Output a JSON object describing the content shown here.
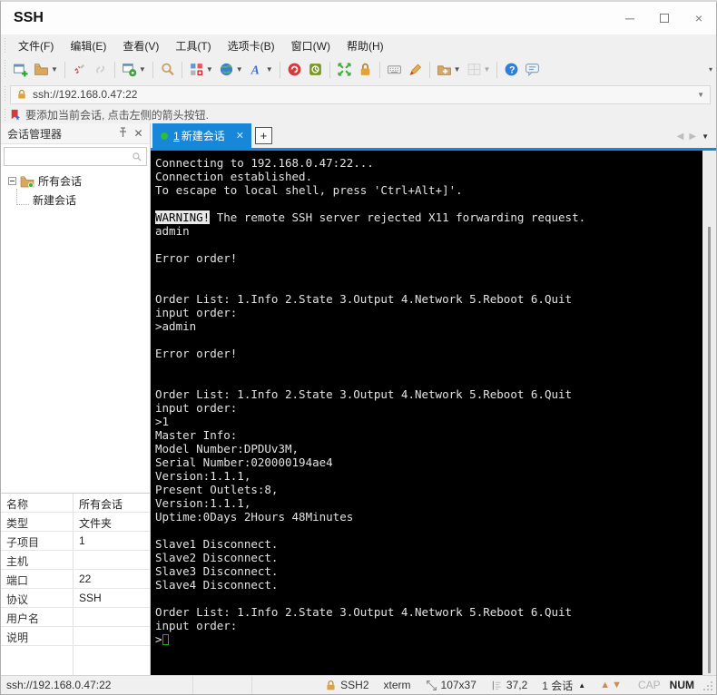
{
  "window": {
    "title": "SSH",
    "controls": [
      {
        "name": "minimize-button"
      },
      {
        "name": "maximize-button"
      },
      {
        "name": "close-button"
      }
    ]
  },
  "menu_bar": {
    "items": [
      "文件(F)",
      "编辑(E)",
      "查看(V)",
      "工具(T)",
      "选项卡(B)",
      "窗口(W)",
      "帮助(H)"
    ]
  },
  "toolbar": {
    "items": [
      {
        "name": "new-session-icon"
      },
      {
        "name": "open-folder-icon",
        "dropdown": true
      },
      {
        "sep": true
      },
      {
        "name": "disconnect-icon"
      },
      {
        "name": "reconnect-icon",
        "disabled": true
      },
      {
        "sep": true
      },
      {
        "name": "session-properties-icon",
        "dropdown": true
      },
      {
        "sep": true
      },
      {
        "name": "find-icon"
      },
      {
        "sep": true
      },
      {
        "name": "compose-icon",
        "dropdown": true
      },
      {
        "name": "globe-icon",
        "dropdown": true
      },
      {
        "name": "font-icon",
        "dropdown": true
      },
      {
        "sep": true
      },
      {
        "name": "xagent-icon"
      },
      {
        "name": "xftp-icon"
      },
      {
        "sep": true
      },
      {
        "name": "fullscreen-icon"
      },
      {
        "name": "lock-icon"
      },
      {
        "sep": true
      },
      {
        "name": "keyboard-icon"
      },
      {
        "name": "highlight-pen-icon"
      },
      {
        "sep": true
      },
      {
        "name": "new-folder-icon",
        "dropdown": true
      },
      {
        "name": "layout-grid-icon",
        "dropdown": true,
        "disabled": true
      },
      {
        "sep": true
      },
      {
        "name": "help-icon"
      },
      {
        "name": "feedback-icon"
      }
    ]
  },
  "address_bar": {
    "value": "ssh://192.168.0.47:22"
  },
  "info_bar": {
    "text": "要添加当前会话, 点击左侧的箭头按钮."
  },
  "session_manager": {
    "title": "会话管理器",
    "search_value": "",
    "tree": [
      {
        "label": "所有会话",
        "level": 0,
        "expanded": true,
        "icon": "sessions-folder-icon"
      },
      {
        "label": "新建会话",
        "level": 1
      }
    ]
  },
  "properties": {
    "rows": [
      {
        "label": "名称",
        "value": "所有会话"
      },
      {
        "label": "类型",
        "value": "文件夹"
      },
      {
        "label": "子项目",
        "value": "1"
      },
      {
        "label": "主机",
        "value": ""
      },
      {
        "label": "端口",
        "value": "22"
      },
      {
        "label": "协议",
        "value": "SSH"
      },
      {
        "label": "用户名",
        "value": ""
      },
      {
        "label": "说明",
        "value": ""
      }
    ]
  },
  "tabs": {
    "active": {
      "index": "1",
      "label": "新建会话",
      "status_dot_color": "#2fbe2f"
    },
    "new_tab_label": "+"
  },
  "terminal": {
    "background": "#000000",
    "foreground": "#e2e2e2",
    "cursor_color": "#00c000",
    "lines": [
      [
        {
          "t": "Connecting to 192.168.0.47:22..."
        }
      ],
      [
        {
          "t": "Connection established."
        }
      ],
      [
        {
          "t": "To escape to local shell, press 'Ctrl+Alt+]'."
        }
      ],
      [],
      [
        {
          "t": "WARNING!",
          "inv": true
        },
        {
          "t": " The remote SSH server rejected X11 forwarding request."
        }
      ],
      [
        {
          "t": "admin"
        }
      ],
      [],
      [
        {
          "t": "Error order!"
        }
      ],
      [],
      [],
      [
        {
          "t": "Order List: 1.Info 2.State 3.Output 4.Network 5.Reboot 6.Quit"
        }
      ],
      [
        {
          "t": "input order:"
        }
      ],
      [
        {
          "t": ">admin"
        }
      ],
      [],
      [
        {
          "t": "Error order!"
        }
      ],
      [],
      [],
      [
        {
          "t": "Order List: 1.Info 2.State 3.Output 4.Network 5.Reboot 6.Quit"
        }
      ],
      [
        {
          "t": "input order:"
        }
      ],
      [
        {
          "t": ">1"
        }
      ],
      [
        {
          "t": "Master Info:"
        }
      ],
      [
        {
          "t": "Model Number:DPDUv3M,"
        }
      ],
      [
        {
          "t": "Serial Number:020000194ae4"
        }
      ],
      [
        {
          "t": "Version:1.1.1,"
        }
      ],
      [
        {
          "t": "Present Outlets:8,"
        }
      ],
      [
        {
          "t": "Version:1.1.1,"
        }
      ],
      [
        {
          "t": "Uptime:0Days 2Hours 48Minutes"
        }
      ],
      [],
      [
        {
          "t": "Slave1 Disconnect."
        }
      ],
      [
        {
          "t": "Slave2 Disconnect."
        }
      ],
      [
        {
          "t": "Slave3 Disconnect."
        }
      ],
      [
        {
          "t": "Slave4 Disconnect."
        }
      ],
      [],
      [
        {
          "t": "Order List: 1.Info 2.State 3.Output 4.Network 5.Reboot 6.Quit"
        }
      ],
      [
        {
          "t": "input order:"
        }
      ],
      [
        {
          "t": ">"
        },
        {
          "t": "",
          "cursor": true
        }
      ]
    ]
  },
  "status_bar": {
    "url": "ssh://192.168.0.47:22",
    "protocol": "SSH2",
    "terminal_type": "xterm",
    "size": "107x37",
    "cursor_pos": "37,2",
    "sessions": "1 会话",
    "cap_label": "CAP",
    "num_label": "NUM"
  },
  "colors": {
    "accent_tab_blue": "#1687d9",
    "status_dot_green": "#2fbe2f",
    "lock_orange": "#e0a33a",
    "flag_red": "#d53a3a"
  }
}
